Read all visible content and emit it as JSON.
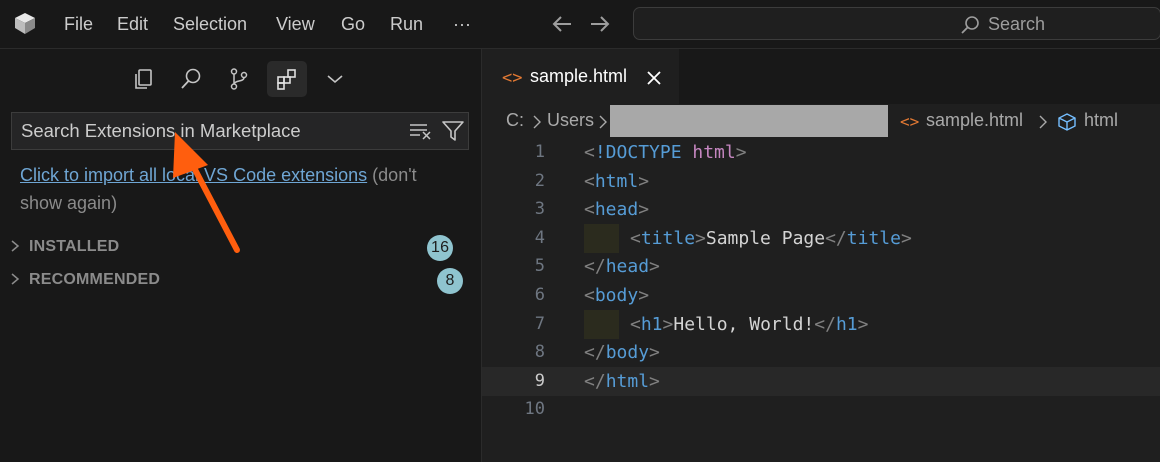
{
  "menu": [
    "File",
    "Edit",
    "Selection",
    "View",
    "Go",
    "Run",
    "···"
  ],
  "command_center": {
    "placeholder": "Search"
  },
  "sidebar": {
    "activity_icons": [
      "explorer-icon",
      "search-icon",
      "source-control-icon",
      "extensions-icon",
      "chevron-down-icon"
    ],
    "search_placeholder": "Search Extensions in Marketplace",
    "import_link": "Click to import all local VS Code extensions",
    "import_suffix": "(don't show again)",
    "sections": [
      {
        "label": "INSTALLED",
        "count": "16"
      },
      {
        "label": "RECOMMENDED",
        "count": "8"
      }
    ]
  },
  "editor": {
    "tab": {
      "label": "sample.html",
      "icon": "<>"
    },
    "breadcrumbs": {
      "drive": "C:",
      "users": "Users",
      "file": "sample.html",
      "symbol": "html"
    },
    "lines": [
      {
        "n": "1",
        "text": "<!DOCTYPE html>"
      },
      {
        "n": "2",
        "text": "<html>"
      },
      {
        "n": "3",
        "text": "<head>"
      },
      {
        "n": "4",
        "text": "<title>Sample Page</title>"
      },
      {
        "n": "5",
        "text": "</head>"
      },
      {
        "n": "6",
        "text": "<body>"
      },
      {
        "n": "7",
        "text": "<h1>Hello, World!</h1>"
      },
      {
        "n": "8",
        "text": "</body>"
      },
      {
        "n": "9",
        "text": "</html>"
      },
      {
        "n": "10",
        "text": ""
      }
    ],
    "current_line": 9
  },
  "colors": {
    "accent_orange_arrow": "#ff5e0e",
    "badge": "#8fc4cf",
    "link": "#6fa6d4",
    "html_icon": "#e37933"
  }
}
